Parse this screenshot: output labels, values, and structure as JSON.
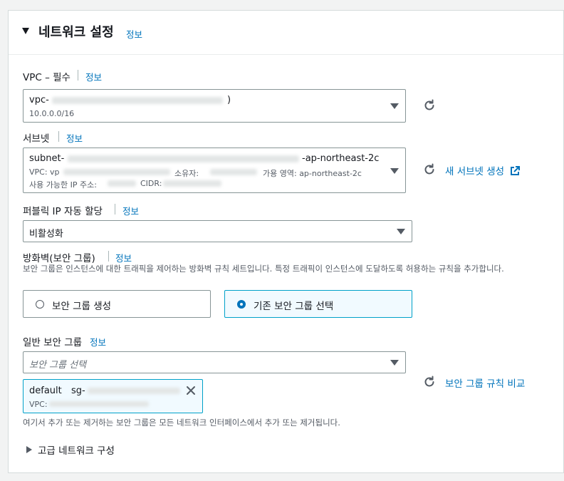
{
  "section": {
    "title": "네트워크 설정",
    "info": "정보",
    "expanded": true
  },
  "vpc": {
    "label": "VPC – 필수",
    "info": "정보",
    "selected_prefix": "vpc-",
    "selected_suffix": ")",
    "cidr": "10.0.0.0/16"
  },
  "subnet": {
    "label": "서브넷",
    "info": "정보",
    "selected_prefix": "subnet-",
    "selected_suffix": "-ap-northeast-2c",
    "line2_vpc": "VPC: vp",
    "line2_owner": "소유자:",
    "line2_az_label": "가용 영역:",
    "line2_az": "ap-northeast-2c",
    "line3_ip": "사용 가능한 IP 주소:",
    "line3_cidr": "CIDR:",
    "create_link": "새 서브넷 생성"
  },
  "public_ip": {
    "label": "퍼블릭 IP 자동 할당",
    "info": "정보",
    "value": "비활성화"
  },
  "firewall": {
    "label": "방화벽(보안 그룹)",
    "info": "정보",
    "description": "보안 그룹은 인스턴스에 대한 트래픽을 제어하는 방화벽 규칙 세트입니다. 특정 트래픽이 인스턴스에 도달하도록 허용하는 규칙을 추가합니다.",
    "options": [
      {
        "label": "보안 그룹 생성",
        "selected": false
      },
      {
        "label": "기존 보안 그룹 선택",
        "selected": true
      }
    ]
  },
  "common_sg": {
    "label": "일반 보안 그룹",
    "info": "정보",
    "placeholder": "보안 그룹 선택",
    "compare_link": "보안 그룹 규칙 비교",
    "token_name": "default",
    "token_id_prefix": "sg-",
    "token_sub": "VPC:",
    "help": "여기서 추가 또는 제거하는 보안 그룹은 모든 네트워크 인터페이스에서 추가 또는 제거됩니다."
  },
  "advanced": {
    "label": "고급 네트워크 구성",
    "expanded": false
  },
  "colors": {
    "link": "#0073bb",
    "selected_border": "#00a1c9",
    "selected_bg": "#f1faff"
  }
}
